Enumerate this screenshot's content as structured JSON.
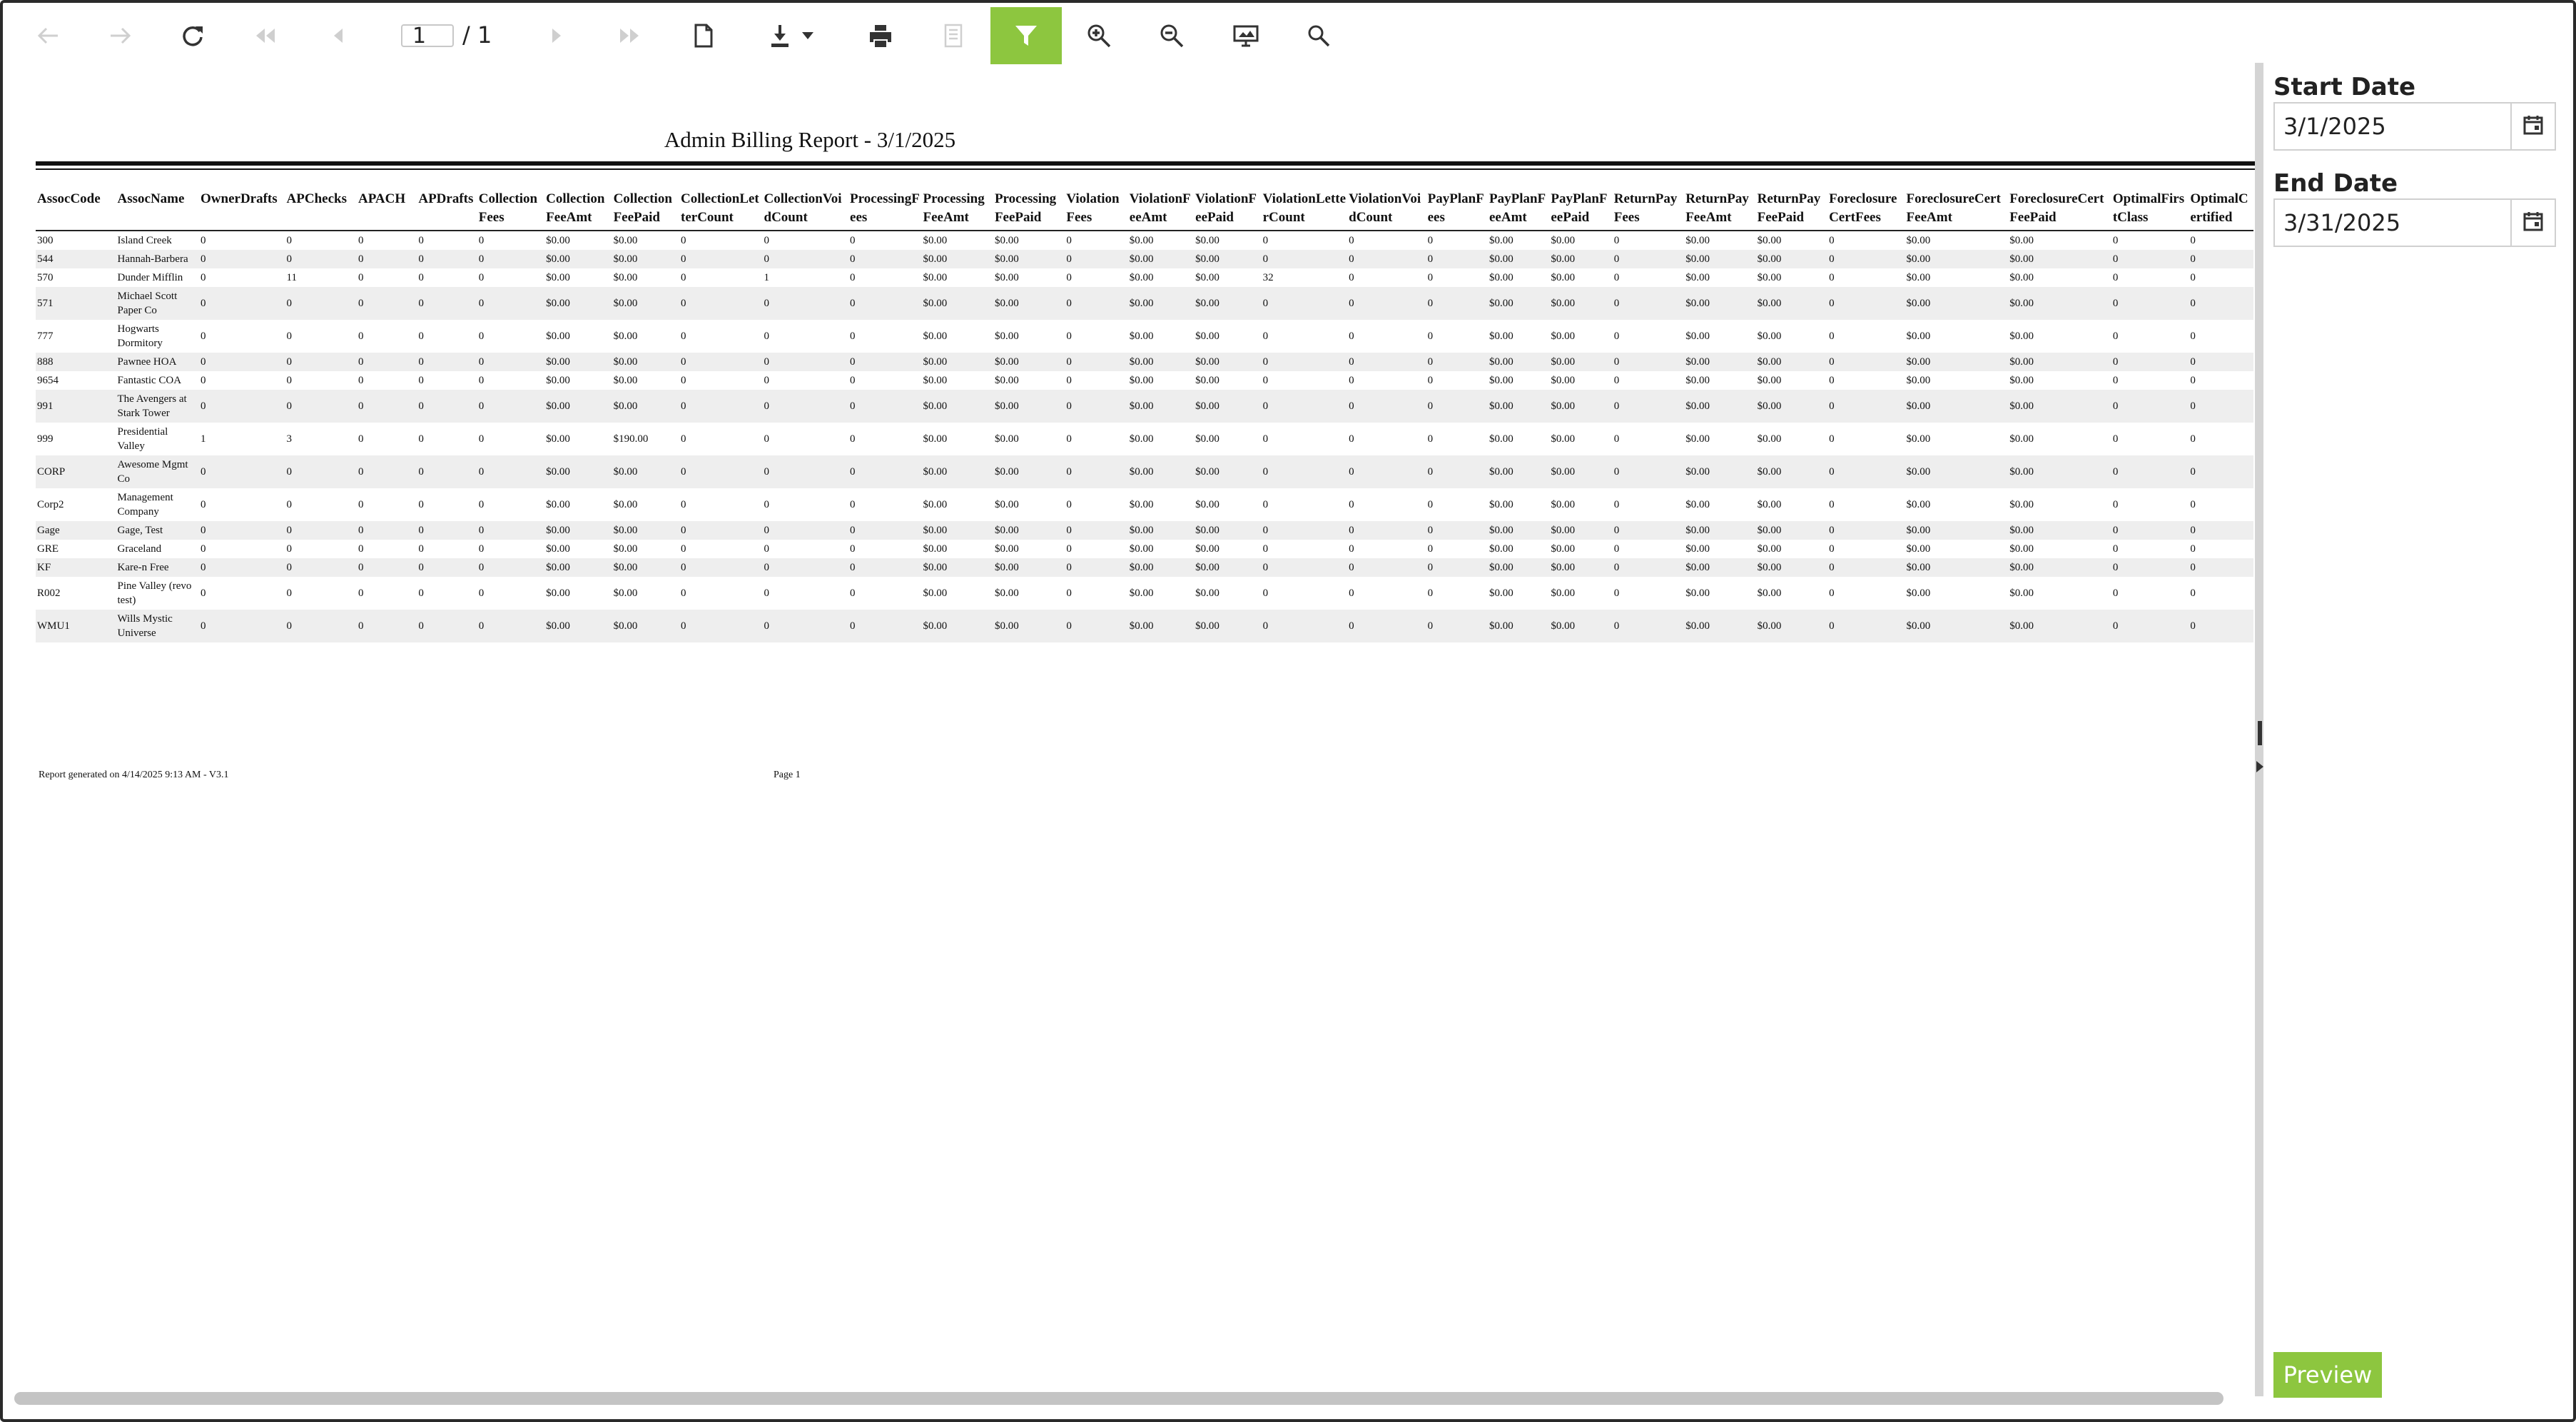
{
  "toolbar": {
    "page_current": "1",
    "page_total": "/ 1",
    "buttons": [
      {
        "name": "back-icon",
        "enabled": false
      },
      {
        "name": "forward-icon",
        "enabled": false
      },
      {
        "name": "refresh-icon",
        "enabled": true
      },
      {
        "name": "first-page-icon",
        "enabled": false
      },
      {
        "name": "previous-page-icon",
        "enabled": false
      },
      {
        "name": "next-page-icon",
        "enabled": false
      },
      {
        "name": "last-page-icon",
        "enabled": false
      },
      {
        "name": "document-map-icon",
        "enabled": true
      },
      {
        "name": "export-download-icon",
        "enabled": true
      },
      {
        "name": "print-icon",
        "enabled": true
      },
      {
        "name": "print-preview-icon",
        "enabled": false
      },
      {
        "name": "parameters-filter-icon",
        "enabled": true,
        "active": true
      },
      {
        "name": "zoom-in-icon",
        "enabled": true
      },
      {
        "name": "zoom-out-icon",
        "enabled": true
      },
      {
        "name": "toggle-view-icon",
        "enabled": true
      },
      {
        "name": "search-icon",
        "enabled": true
      }
    ],
    "active_color": "#8dc63f"
  },
  "report": {
    "title": "Admin Billing Report - 3/1/2025",
    "columns": [
      "AssocCode",
      "AssocName",
      "OwnerDrafts",
      "APChecks",
      "APACH",
      "APDrafts",
      "CollectionFees",
      "CollectionFeeAmt",
      "CollectionFeePaid",
      "CollectionLetterCount",
      "CollectionVoidCount",
      "ProcessingFees",
      "ProcessingFeeAmt",
      "ProcessingFeePaid",
      "ViolationFees",
      "ViolationFeeAmt",
      "ViolationFeePaid",
      "ViolationLetterCount",
      "ViolationVoidCount",
      "PayPlanFees",
      "PayPlanFeeAmt",
      "PayPlanFeePaid",
      "ReturnPayFees",
      "ReturnPayFeeAmt",
      "ReturnPayFeePaid",
      "ForeclosureCertFees",
      "ForeclosureCertFeeAmt",
      "ForeclosureCertFeePaid",
      "OptimalFirstClass",
      "OptimalCertified"
    ],
    "rows": [
      [
        "300",
        "Island Creek",
        "0",
        "0",
        "0",
        "0",
        "0",
        "$0.00",
        "$0.00",
        "0",
        "0",
        "0",
        "$0.00",
        "$0.00",
        "0",
        "$0.00",
        "$0.00",
        "0",
        "0",
        "0",
        "$0.00",
        "$0.00",
        "0",
        "$0.00",
        "$0.00",
        "0",
        "$0.00",
        "$0.00",
        "0",
        "0"
      ],
      [
        "544",
        "Hannah-Barbera",
        "0",
        "0",
        "0",
        "0",
        "0",
        "$0.00",
        "$0.00",
        "0",
        "0",
        "0",
        "$0.00",
        "$0.00",
        "0",
        "$0.00",
        "$0.00",
        "0",
        "0",
        "0",
        "$0.00",
        "$0.00",
        "0",
        "$0.00",
        "$0.00",
        "0",
        "$0.00",
        "$0.00",
        "0",
        "0"
      ],
      [
        "570",
        "Dunder Mifflin",
        "0",
        "11",
        "0",
        "0",
        "0",
        "$0.00",
        "$0.00",
        "0",
        "1",
        "0",
        "$0.00",
        "$0.00",
        "0",
        "$0.00",
        "$0.00",
        "32",
        "0",
        "0",
        "$0.00",
        "$0.00",
        "0",
        "$0.00",
        "$0.00",
        "0",
        "$0.00",
        "$0.00",
        "0",
        "0"
      ],
      [
        "571",
        "Michael Scott Paper Co",
        "0",
        "0",
        "0",
        "0",
        "0",
        "$0.00",
        "$0.00",
        "0",
        "0",
        "0",
        "$0.00",
        "$0.00",
        "0",
        "$0.00",
        "$0.00",
        "0",
        "0",
        "0",
        "$0.00",
        "$0.00",
        "0",
        "$0.00",
        "$0.00",
        "0",
        "$0.00",
        "$0.00",
        "0",
        "0"
      ],
      [
        "777",
        "Hogwarts Dormitory",
        "0",
        "0",
        "0",
        "0",
        "0",
        "$0.00",
        "$0.00",
        "0",
        "0",
        "0",
        "$0.00",
        "$0.00",
        "0",
        "$0.00",
        "$0.00",
        "0",
        "0",
        "0",
        "$0.00",
        "$0.00",
        "0",
        "$0.00",
        "$0.00",
        "0",
        "$0.00",
        "$0.00",
        "0",
        "0"
      ],
      [
        "888",
        "Pawnee HOA",
        "0",
        "0",
        "0",
        "0",
        "0",
        "$0.00",
        "$0.00",
        "0",
        "0",
        "0",
        "$0.00",
        "$0.00",
        "0",
        "$0.00",
        "$0.00",
        "0",
        "0",
        "0",
        "$0.00",
        "$0.00",
        "0",
        "$0.00",
        "$0.00",
        "0",
        "$0.00",
        "$0.00",
        "0",
        "0"
      ],
      [
        "9654",
        "Fantastic COA",
        "0",
        "0",
        "0",
        "0",
        "0",
        "$0.00",
        "$0.00",
        "0",
        "0",
        "0",
        "$0.00",
        "$0.00",
        "0",
        "$0.00",
        "$0.00",
        "0",
        "0",
        "0",
        "$0.00",
        "$0.00",
        "0",
        "$0.00",
        "$0.00",
        "0",
        "$0.00",
        "$0.00",
        "0",
        "0"
      ],
      [
        "991",
        "The Avengers at Stark Tower",
        "0",
        "0",
        "0",
        "0",
        "0",
        "$0.00",
        "$0.00",
        "0",
        "0",
        "0",
        "$0.00",
        "$0.00",
        "0",
        "$0.00",
        "$0.00",
        "0",
        "0",
        "0",
        "$0.00",
        "$0.00",
        "0",
        "$0.00",
        "$0.00",
        "0",
        "$0.00",
        "$0.00",
        "0",
        "0"
      ],
      [
        "999",
        "Presidential Valley",
        "1",
        "3",
        "0",
        "0",
        "0",
        "$0.00",
        "$190.00",
        "0",
        "0",
        "0",
        "$0.00",
        "$0.00",
        "0",
        "$0.00",
        "$0.00",
        "0",
        "0",
        "0",
        "$0.00",
        "$0.00",
        "0",
        "$0.00",
        "$0.00",
        "0",
        "$0.00",
        "$0.00",
        "0",
        "0"
      ],
      [
        "CORP",
        "Awesome Mgmt Co",
        "0",
        "0",
        "0",
        "0",
        "0",
        "$0.00",
        "$0.00",
        "0",
        "0",
        "0",
        "$0.00",
        "$0.00",
        "0",
        "$0.00",
        "$0.00",
        "0",
        "0",
        "0",
        "$0.00",
        "$0.00",
        "0",
        "$0.00",
        "$0.00",
        "0",
        "$0.00",
        "$0.00",
        "0",
        "0"
      ],
      [
        "Corp2",
        "Management Company",
        "0",
        "0",
        "0",
        "0",
        "0",
        "$0.00",
        "$0.00",
        "0",
        "0",
        "0",
        "$0.00",
        "$0.00",
        "0",
        "$0.00",
        "$0.00",
        "0",
        "0",
        "0",
        "$0.00",
        "$0.00",
        "0",
        "$0.00",
        "$0.00",
        "0",
        "$0.00",
        "$0.00",
        "0",
        "0"
      ],
      [
        "Gage",
        "Gage, Test",
        "0",
        "0",
        "0",
        "0",
        "0",
        "$0.00",
        "$0.00",
        "0",
        "0",
        "0",
        "$0.00",
        "$0.00",
        "0",
        "$0.00",
        "$0.00",
        "0",
        "0",
        "0",
        "$0.00",
        "$0.00",
        "0",
        "$0.00",
        "$0.00",
        "0",
        "$0.00",
        "$0.00",
        "0",
        "0"
      ],
      [
        "GRE",
        "Graceland",
        "0",
        "0",
        "0",
        "0",
        "0",
        "$0.00",
        "$0.00",
        "0",
        "0",
        "0",
        "$0.00",
        "$0.00",
        "0",
        "$0.00",
        "$0.00",
        "0",
        "0",
        "0",
        "$0.00",
        "$0.00",
        "0",
        "$0.00",
        "$0.00",
        "0",
        "$0.00",
        "$0.00",
        "0",
        "0"
      ],
      [
        "KF",
        "Kare-n Free",
        "0",
        "0",
        "0",
        "0",
        "0",
        "$0.00",
        "$0.00",
        "0",
        "0",
        "0",
        "$0.00",
        "$0.00",
        "0",
        "$0.00",
        "$0.00",
        "0",
        "0",
        "0",
        "$0.00",
        "$0.00",
        "0",
        "$0.00",
        "$0.00",
        "0",
        "$0.00",
        "$0.00",
        "0",
        "0"
      ],
      [
        "R002",
        "Pine Valley (revo test)",
        "0",
        "0",
        "0",
        "0",
        "0",
        "$0.00",
        "$0.00",
        "0",
        "0",
        "0",
        "$0.00",
        "$0.00",
        "0",
        "$0.00",
        "$0.00",
        "0",
        "0",
        "0",
        "$0.00",
        "$0.00",
        "0",
        "$0.00",
        "$0.00",
        "0",
        "$0.00",
        "$0.00",
        "0",
        "0"
      ],
      [
        "WMU1",
        "Wills Mystic Universe",
        "0",
        "0",
        "0",
        "0",
        "0",
        "$0.00",
        "$0.00",
        "0",
        "0",
        "0",
        "$0.00",
        "$0.00",
        "0",
        "$0.00",
        "$0.00",
        "0",
        "0",
        "0",
        "$0.00",
        "$0.00",
        "0",
        "$0.00",
        "$0.00",
        "0",
        "$0.00",
        "$0.00",
        "0",
        "0"
      ]
    ],
    "footer_generated": "Report generated on 4/14/2025 9:13 AM - V3.1",
    "footer_page": "Page 1"
  },
  "params": {
    "start_label": "Start Date",
    "start_value": "3/1/2025",
    "end_label": "End Date",
    "end_value": "3/31/2025",
    "preview_label": "Preview",
    "preview_color": "#8dc63f"
  }
}
